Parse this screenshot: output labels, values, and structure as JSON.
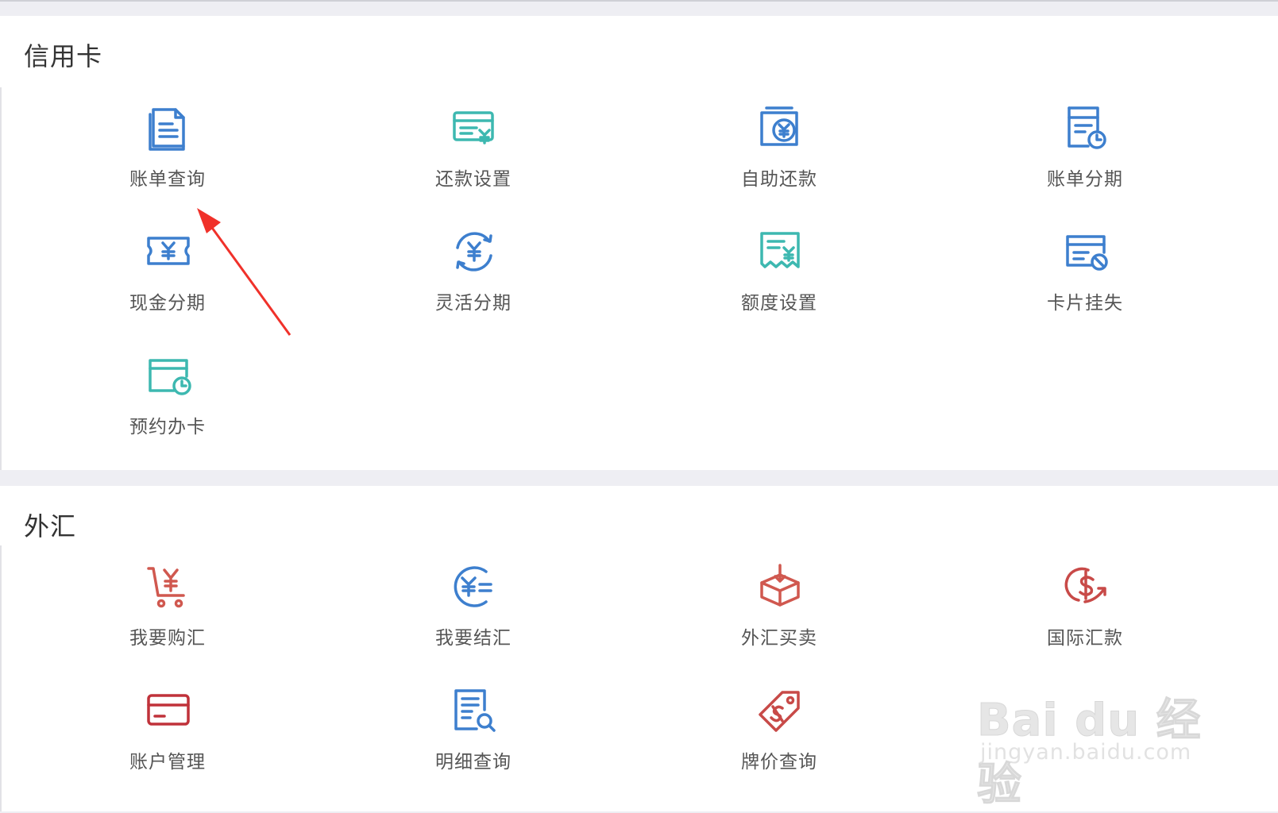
{
  "colors": {
    "blue": "#3d7fce",
    "teal": "#3db8b0",
    "red": "#d0584f",
    "darkred": "#c0323a",
    "arrow": "#f0312a"
  },
  "credit": {
    "title": "信用卡",
    "items": [
      {
        "label": "账单查询",
        "icon": "bill-document-icon"
      },
      {
        "label": "还款设置",
        "icon": "card-yen-settings-icon"
      },
      {
        "label": "自助还款",
        "icon": "wallet-yen-icon"
      },
      {
        "label": "账单分期",
        "icon": "bill-clock-icon"
      },
      {
        "label": "现金分期",
        "icon": "cash-ticket-icon"
      },
      {
        "label": "灵活分期",
        "icon": "yen-cycle-icon"
      },
      {
        "label": "额度设置",
        "icon": "receipt-yen-icon"
      },
      {
        "label": "卡片挂失",
        "icon": "card-blocked-icon"
      },
      {
        "label": "预约办卡",
        "icon": "card-clock-icon"
      }
    ]
  },
  "fx": {
    "title": "外汇",
    "items": [
      {
        "label": "我要购汇",
        "icon": "cart-yen-icon"
      },
      {
        "label": "我要结汇",
        "icon": "yen-exchange-icon"
      },
      {
        "label": "外汇买卖",
        "icon": "box-download-icon"
      },
      {
        "label": "国际汇款",
        "icon": "dollar-arrow-icon"
      },
      {
        "label": "账户管理",
        "icon": "bank-card-icon"
      },
      {
        "label": "明细查询",
        "icon": "document-search-icon"
      },
      {
        "label": "牌价查询",
        "icon": "price-tag-icon"
      }
    ]
  },
  "watermark": {
    "brand": "Bai du 经验",
    "url": "jingyan.baidu.com"
  }
}
